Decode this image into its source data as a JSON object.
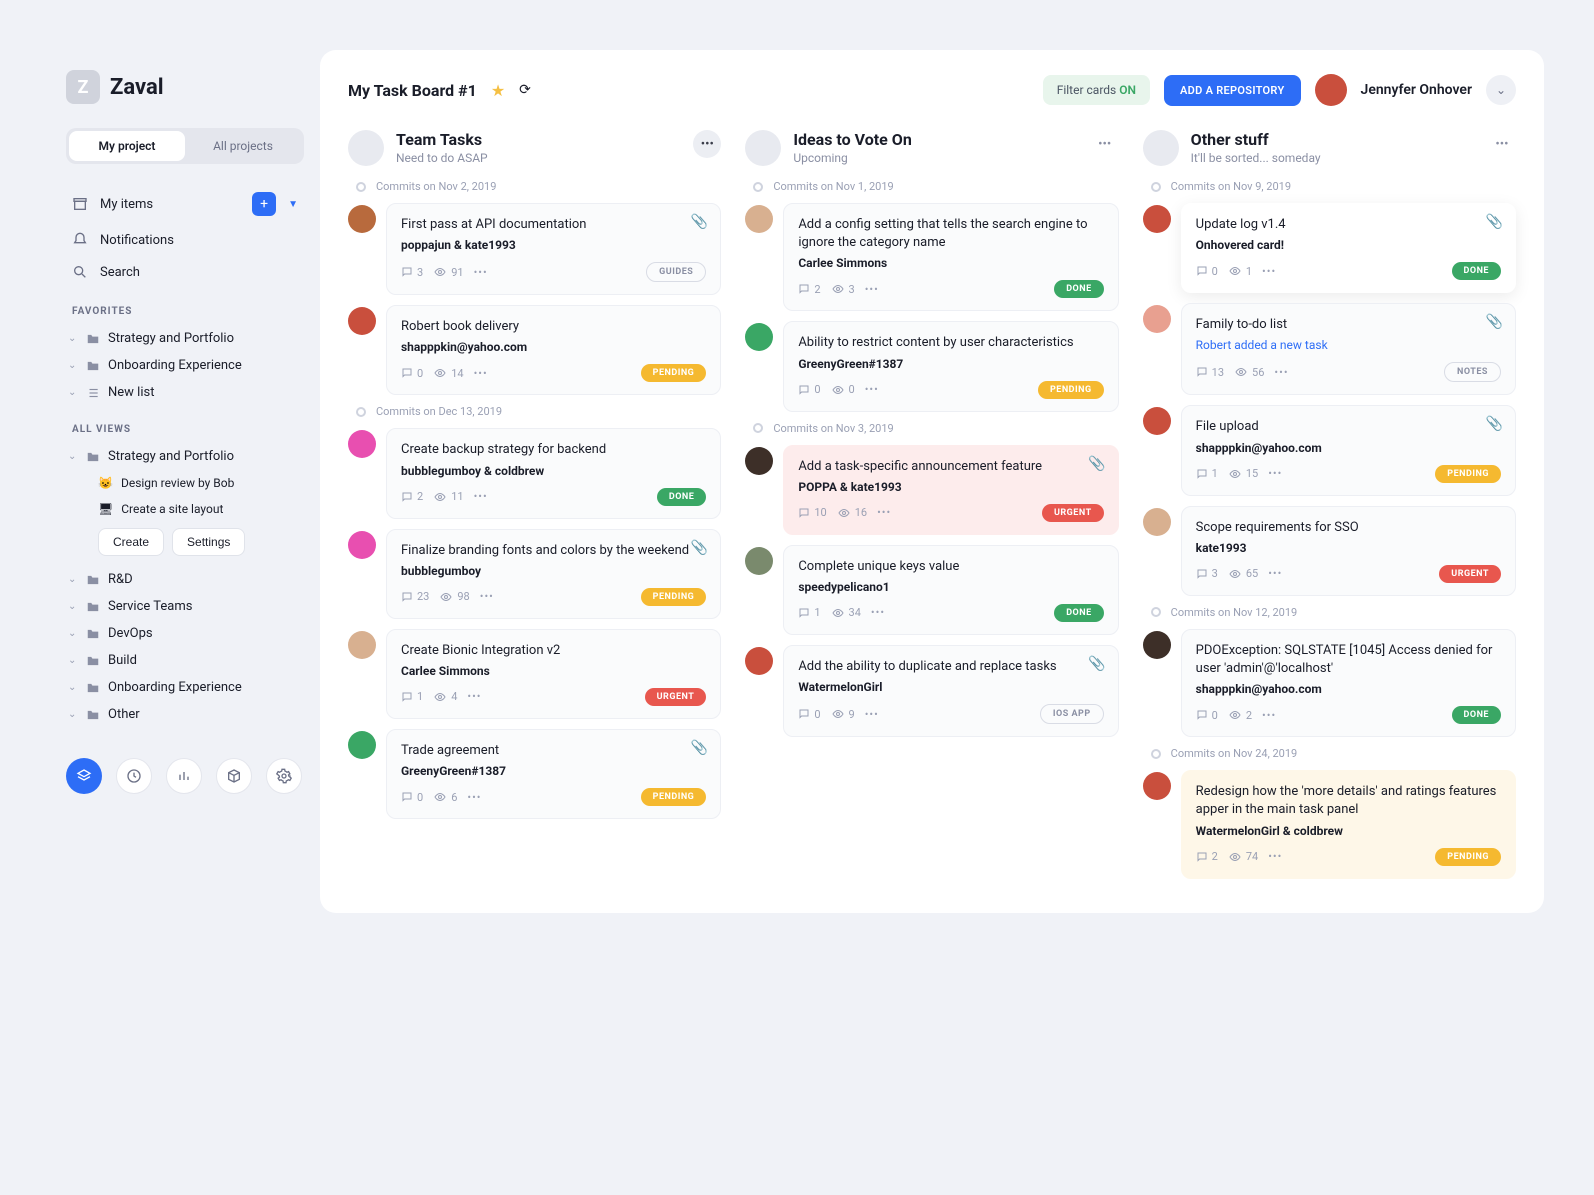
{
  "app": {
    "name": "Zaval",
    "logo_letter": "Z"
  },
  "tabs": {
    "my_project": "My project",
    "all_projects": "All projects"
  },
  "nav": {
    "my_items": "My items",
    "notifications": "Notifications",
    "search": "Search"
  },
  "favorites_label": "FAVORITES",
  "favorites": [
    {
      "label": "Strategy and Portfolio"
    },
    {
      "label": "Onboarding Experience"
    },
    {
      "label": "New list",
      "icon": "list"
    }
  ],
  "all_views_label": "ALL VIEWS",
  "views": {
    "primary": {
      "label": "Strategy and Portfolio",
      "children": [
        {
          "emoji": "😺",
          "label": "Design review by Bob"
        },
        {
          "emoji": "🖥",
          "label": "Create a site layout"
        }
      ],
      "create": "Create",
      "settings": "Settings"
    },
    "others": [
      "R&D",
      "Service Teams",
      "DevOps",
      "Build",
      "Onboarding Experience",
      "Other"
    ]
  },
  "topbar": {
    "board_title": "My Task Board #1",
    "filter_text": "Filter cards ",
    "filter_state": "ON",
    "add_repo": "ADD A REPOSITORY",
    "user": "Jennyfer Onhover"
  },
  "columns": [
    {
      "title": "Team Tasks",
      "sub": "Need to do ASAP",
      "menu_style": "filled",
      "groups": [
        {
          "sep": "Commits on Nov 2, 2019",
          "cards": [
            {
              "title": "First pass at API documentation",
              "author": "poppajun & kate1993",
              "comments": "3",
              "views": "91",
              "badge": "GUIDES",
              "badge_type": "outline",
              "clip": true,
              "av": "#b86a3d"
            },
            {
              "title": "Robert book delivery",
              "author": "shapppkin@yahoo.com",
              "comments": "0",
              "views": "14",
              "badge": "PENDING",
              "badge_type": "pending",
              "av": "#c94f3d"
            }
          ]
        },
        {
          "sep": "Commits on Dec 13, 2019",
          "cards": [
            {
              "title": "Create backup strategy for backend",
              "author": "bubblegumboy & coldbrew",
              "comments": "2",
              "views": "11",
              "badge": "DONE",
              "badge_type": "done",
              "av": "#e84fb0"
            },
            {
              "title": "Finalize branding fonts and colors by the weekend",
              "author": "bubblegumboy",
              "comments": "23",
              "views": "98",
              "badge": "PENDING",
              "badge_type": "pending",
              "clip": true,
              "av": "#e84fb0"
            },
            {
              "title": "Create Bionic Integration v2",
              "author": "Carlee Simmons",
              "comments": "1",
              "views": "4",
              "badge": "URGENT",
              "badge_type": "urgent",
              "av": "#d8b090"
            },
            {
              "title": "Trade agreement",
              "author": "GreenyGreen#1387",
              "comments": "0",
              "views": "6",
              "badge": "PENDING",
              "badge_type": "pending",
              "clip": true,
              "av": "#3aa765"
            }
          ]
        }
      ]
    },
    {
      "title": "Ideas to Vote On",
      "sub": "Upcoming",
      "menu_style": "plain",
      "groups": [
        {
          "sep": "Commits on Nov 1, 2019",
          "cards": [
            {
              "title": "Add a config setting that tells the search engine to ignore the category name",
              "author": "Carlee Simmons",
              "comments": "2",
              "views": "3",
              "badge": "DONE",
              "badge_type": "done",
              "av": "#d8b090"
            },
            {
              "title": "Ability to restrict content by user characteristics",
              "author": "GreenyGreen#1387",
              "comments": "0",
              "views": "0",
              "badge": "PENDING",
              "badge_type": "pending",
              "av": "#3aa765"
            }
          ]
        },
        {
          "sep": "Commits on Nov 3, 2019",
          "cards": [
            {
              "title": "Add a task-specific announcement feature",
              "author": "POPPA & kate1993",
              "comments": "10",
              "views": "16",
              "badge": "URGENT",
              "badge_type": "urgent",
              "clip": true,
              "card_style": "red",
              "av": "#3d2f28"
            },
            {
              "title": "Complete unique keys value",
              "author": "speedypelicano1",
              "comments": "1",
              "views": "34",
              "badge": "DONE",
              "badge_type": "done",
              "av": "#7a8a6d"
            },
            {
              "title": "Add the ability to duplicate and replace tasks",
              "author": "WatermelonGirl",
              "comments": "0",
              "views": "9",
              "badge": "IOS APP",
              "badge_type": "outline",
              "clip": true,
              "av": "#c94f3d"
            }
          ]
        }
      ]
    },
    {
      "title": "Other stuff",
      "sub": "It'll be sorted... someday",
      "menu_style": "plain",
      "groups": [
        {
          "sep": "Commits on Nov 9, 2019",
          "cards": [
            {
              "title": "Update log v1.4",
              "author": "Onhovered card!",
              "comments": "0",
              "views": "1",
              "badge": "DONE",
              "badge_type": "done",
              "clip": true,
              "card_style": "hover",
              "av": "#c94f3d"
            },
            {
              "title": "Family to-do list",
              "link": "Robert added a new task",
              "comments": "13",
              "views": "56",
              "badge": "NOTES",
              "badge_type": "outline",
              "clip": true,
              "av": "#e8a090"
            },
            {
              "title": "File upload",
              "author": "shapppkin@yahoo.com",
              "comments": "1",
              "views": "15",
              "badge": "PENDING",
              "badge_type": "pending",
              "clip": true,
              "av": "#c94f3d"
            },
            {
              "title": "Scope requirements for SSO",
              "author": "kate1993",
              "comments": "3",
              "views": "65",
              "badge": "URGENT",
              "badge_type": "urgent",
              "av": "#d8b090"
            }
          ]
        },
        {
          "sep": "Commits on Nov 12, 2019",
          "cards": [
            {
              "title": "PDOException: SQLSTATE [1045] Access denied for user 'admin'@'localhost'",
              "author": "shapppkin@yahoo.com",
              "comments": "0",
              "views": "2",
              "badge": "DONE",
              "badge_type": "done",
              "av": "#3d2f28"
            }
          ]
        },
        {
          "sep": "Commits on Nov 24, 2019",
          "cards": [
            {
              "title": "Redesign how the 'more details' and ratings features apper in the main task panel",
              "author": "WatermelonGirl & coldbrew",
              "comments": "2",
              "views": "74",
              "badge": "PENDING",
              "badge_type": "pending",
              "card_style": "yellow",
              "av": "#c94f3d"
            }
          ]
        }
      ]
    }
  ]
}
